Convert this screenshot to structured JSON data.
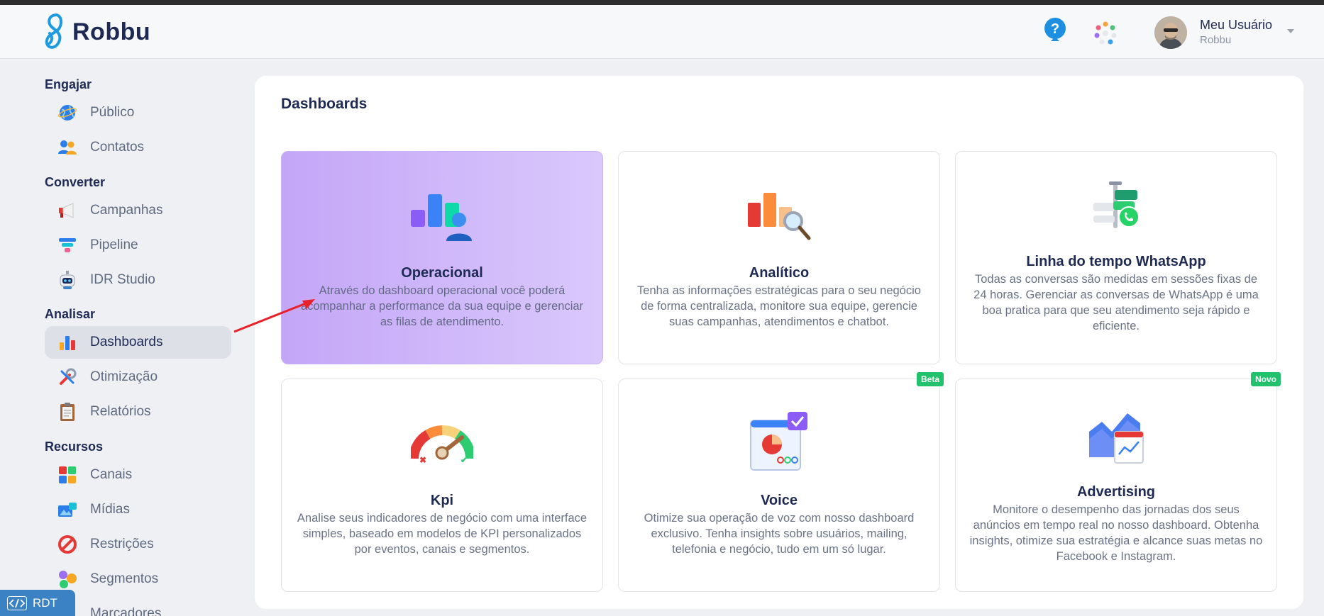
{
  "header": {
    "brand": "Robbu",
    "user_name": "Meu Usuário",
    "user_org": "Robbu",
    "icons": [
      "help-icon",
      "apps-icon",
      "avatar",
      "chevron-down-icon"
    ]
  },
  "sidebar": {
    "sections": [
      {
        "title": "Engajar",
        "items": [
          {
            "label": "Público",
            "icon": "globe-icon"
          },
          {
            "label": "Contatos",
            "icon": "contacts-icon"
          }
        ]
      },
      {
        "title": "Converter",
        "items": [
          {
            "label": "Campanhas",
            "icon": "megaphone-icon"
          },
          {
            "label": "Pipeline",
            "icon": "funnel-icon"
          },
          {
            "label": "IDR Studio",
            "icon": "robot-icon"
          }
        ]
      },
      {
        "title": "Analisar",
        "items": [
          {
            "label": "Dashboards",
            "icon": "bar-chart-icon",
            "active": true
          },
          {
            "label": "Otimização",
            "icon": "tools-icon"
          },
          {
            "label": "Relatórios",
            "icon": "clipboard-icon"
          }
        ]
      },
      {
        "title": "Recursos",
        "items": [
          {
            "label": "Canais",
            "icon": "channels-icon"
          },
          {
            "label": "Mídias",
            "icon": "media-icon"
          },
          {
            "label": "Restrições",
            "icon": "prohibited-icon"
          },
          {
            "label": "Segmentos",
            "icon": "segments-icon"
          },
          {
            "label": "Marcadores",
            "icon": "tag-icon"
          }
        ]
      }
    ]
  },
  "rdt": {
    "label": "RDT",
    "icon": "code-icon"
  },
  "main": {
    "title": "Dashboards",
    "cards": [
      {
        "title": "Operacional",
        "description": "Através do dashboard operacional você poderá acompanhar a performance da sua equipe e gerenciar as filas de atendimento.",
        "icon": "operational-chart-icon",
        "active": true
      },
      {
        "title": "Analítico",
        "description": "Tenha as informações estratégicas para o seu negócio de forma centralizada, monitore sua equipe, gerencie suas campanhas, atendimentos e chatbot.",
        "icon": "analytics-magnifier-icon"
      },
      {
        "title": "Linha do tempo WhatsApp",
        "description": "Todas as conversas são medidas em sessões fixas de 24 horas. Gerenciar as conversas de WhatsApp é uma boa pratica para que seu atendimento seja rápido e eficiente.",
        "icon": "whatsapp-timeline-icon"
      },
      {
        "title": "Kpi",
        "description": "Analise seus indicadores de negócio com uma interface simples, baseado em modelos de KPI personalizados por eventos, canais e segmentos.",
        "icon": "gauge-icon"
      },
      {
        "title": "Voice",
        "description": "Otimize sua operação de voz com nosso dashboard exclusivo. Tenha insights sobre usuários, mailing, telefonia e negócio, tudo em um só lugar.",
        "icon": "voice-dashboard-icon",
        "badge": "Beta"
      },
      {
        "title": "Advertising",
        "description": "Monitore o desempenho das jornadas dos seus anúncios em tempo real no nosso dashboard. Obtenha insights, otimize sua estratégia e alcance suas metas no Facebook e Instagram.",
        "icon": "advertising-chart-icon",
        "badge": "Novo"
      }
    ]
  }
}
